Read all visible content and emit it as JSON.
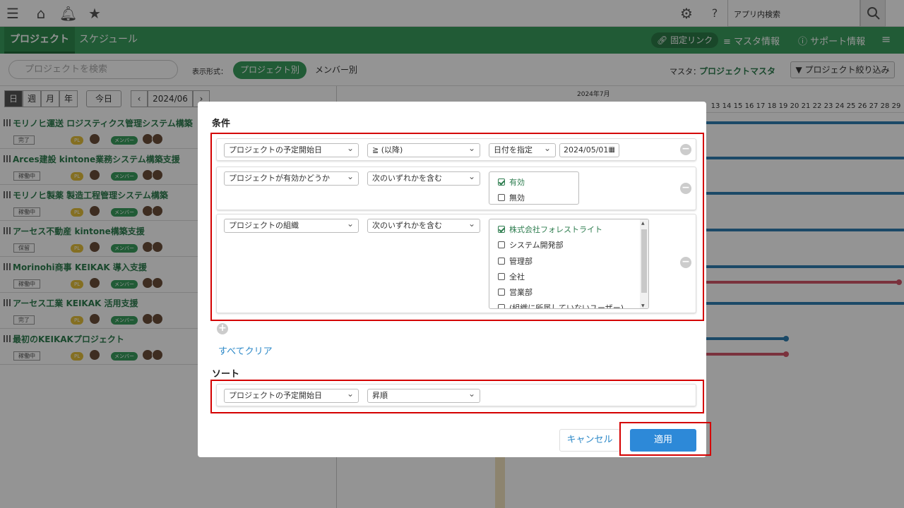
{
  "topbar": {
    "search_placeholder": "アプリ内検索"
  },
  "nav": {
    "tabs": [
      {
        "label": "プロジェクト"
      },
      {
        "label": "スケジュール"
      }
    ],
    "right": {
      "fixed_link": "固定リンク",
      "master_info": "マスタ情報",
      "support_info": "サポート情報"
    }
  },
  "filterbar": {
    "search_placeholder": "プロジェクトを検索",
    "display_label": "表示形式：",
    "view_project": "プロジェクト別",
    "view_member": "メンバー別",
    "master_label": "マスタ：",
    "master_link": "プロジェクトマスタ",
    "narrow_button": "プロジェクト絞り込み"
  },
  "calendar": {
    "day": "日",
    "week": "週",
    "month": "月",
    "year": "年",
    "today": "今日",
    "current": "2024/06",
    "month_label": "2024年7月",
    "days": [
      "13",
      "14",
      "15",
      "16",
      "17",
      "18",
      "19",
      "20",
      "21",
      "22",
      "23",
      "24",
      "25",
      "26",
      "27",
      "28",
      "29"
    ]
  },
  "projects": [
    {
      "name": "モリノヒ運送 ロジスティクス管理システム構築",
      "status": "完了"
    },
    {
      "name": "Arces建設 kintone業務システム構築支援",
      "status": "稼働中"
    },
    {
      "name": "モリノヒ製薬 製造工程管理システム構築",
      "status": "稼働中"
    },
    {
      "name": "アーセス不動産 kintone構築支援",
      "status": "保留"
    },
    {
      "name": "Morinohi商事 KEIKAK 導入支援",
      "status": "稼働中"
    },
    {
      "name": "アーセス工業 KEIKAK 活用支援",
      "status": "完了"
    },
    {
      "name": "最初のKEIKAKプロジェクト",
      "status": "稼働中"
    }
  ],
  "badges": {
    "pl": "PL",
    "member": "メンバー"
  },
  "modal": {
    "conditions_title": "条件",
    "row1": {
      "field": "プロジェクトの予定開始日",
      "operator": "≧ (以降)",
      "date_mode": "日付を指定",
      "date": "2024/05/01"
    },
    "row2": {
      "field": "プロジェクトが有効かどうか",
      "operator": "次のいずれかを含む",
      "options": [
        {
          "label": "有効",
          "checked": true
        },
        {
          "label": "無効",
          "checked": false
        }
      ]
    },
    "row3": {
      "field": "プロジェクトの組織",
      "operator": "次のいずれかを含む",
      "options": [
        {
          "label": "株式会社フォレストライト",
          "checked": true
        },
        {
          "label": "システム開発部",
          "checked": false
        },
        {
          "label": "管理部",
          "checked": false
        },
        {
          "label": "全社",
          "checked": false
        },
        {
          "label": "営業部",
          "checked": false
        },
        {
          "label": "(組織に所属していないユーザー)",
          "checked": false
        }
      ]
    },
    "clear_all": "すべてクリア",
    "sort_title": "ソート",
    "sort": {
      "field": "プロジェクトの予定開始日",
      "order": "昇順"
    },
    "cancel": "キャンセル",
    "apply": "適用"
  },
  "colors": {
    "green": "#3a9d5d",
    "accent_blue": "#2d89d8",
    "highlight_red": "#d40000"
  }
}
